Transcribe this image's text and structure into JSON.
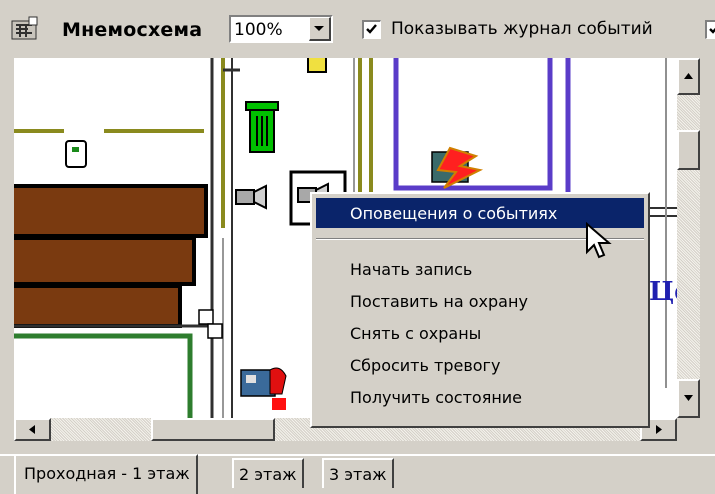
{
  "toolbar": {
    "title": "Мнемосхема",
    "zoom": "100%",
    "show_journal_label": "Показывать журнал событий",
    "show_journal_checked": true
  },
  "map": {
    "partial_label": "Це"
  },
  "context_menu": {
    "items": [
      "Оповещения о событиях",
      "Начать запись",
      "Поставить на охрану",
      "Снять с охраны",
      "Сбросить тревогу",
      "Получить состояние"
    ],
    "highlighted": "Оповещения о событиях"
  },
  "tabs": [
    "Проходная - 1 этаж",
    "2 этаж",
    "3 этаж"
  ],
  "colors": {
    "highlight": "#0a246a",
    "wall_olive": "#8a8a1e",
    "wall_purple": "#5a3cc8",
    "wood": "#7a3a10",
    "green_wall": "#2e7d2e"
  },
  "icons": [
    "app-icon",
    "trash-icon",
    "camera-icon",
    "alarm-icon",
    "pointer-cursor-icon"
  ]
}
